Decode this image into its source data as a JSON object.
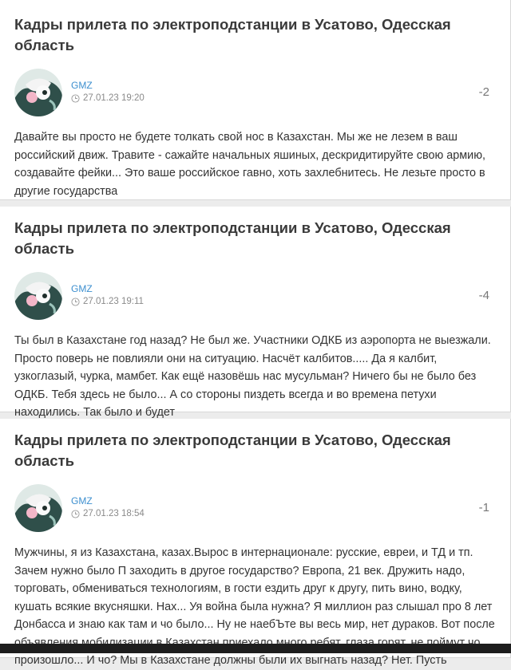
{
  "comments": [
    {
      "post_title": "Кадры прилета по электроподстанции в Усатово, Одесская область",
      "author": "GMZ",
      "date": "27.01.23 19:20",
      "score": "-2",
      "text": "Давайте вы просто не будете толкать свой нос в Казахстан. Мы же не лезем в ваш российский движ. Травите - сажайте начальных яшиных, дескридитируйте свою армию, создавайте фейки... Это ваше российское гавно, хоть захлебнитесь. Не лезьте просто в другие государства"
    },
    {
      "post_title": "Кадры прилета по электроподстанции в Усатово, Одесская область",
      "author": "GMZ",
      "date": "27.01.23 19:11",
      "score": "-4",
      "text": "Ты был в Казахстане год назад? Не был же. Участники ОДКБ из аэропорта не выезжали. Просто поверь не повлияли они на ситуацию. Насчёт калбитов..... Да я калбит, узкоглазый, чурка, мамбет. Как ещё назовёшь нас мусульман? Ничего бы не было без ОДКБ. Тебя здесь не было... А со стороны пиздеть всегда и во времена петухи находились. Так было и будет"
    },
    {
      "post_title": "Кадры прилета по электроподстанции в Усатово, Одесская область",
      "author": "GMZ",
      "date": "27.01.23 18:54",
      "score": "-1",
      "text": "Мужчины, я из Казахстана, казах.Вырос в интернационале: русские, евреи, и ТД и тп. Зачем нужно было П заходить в другое государство? Европа, 21 век. Дружить надо, торговать, обмениваться технологиям, в гости ездить друг к другу, пить вино, водку, кушать всякие вкусняшки. Нах... Уя война была нужна? Я миллион раз слышал про 8 лет Донбасса и знаю как там и чо было... Ну не наебЪте вы весь мир, нет дураков. Вот после объявления мобилизации в Казахстан приехало много ребят, глаза горят, не поймут чо произошло... И чо? Мы в Казахстане должны были их выгнать назад? Нет. Пусть"
    }
  ],
  "icons": {
    "date": "clock-icon",
    "avatar": "avatar"
  }
}
